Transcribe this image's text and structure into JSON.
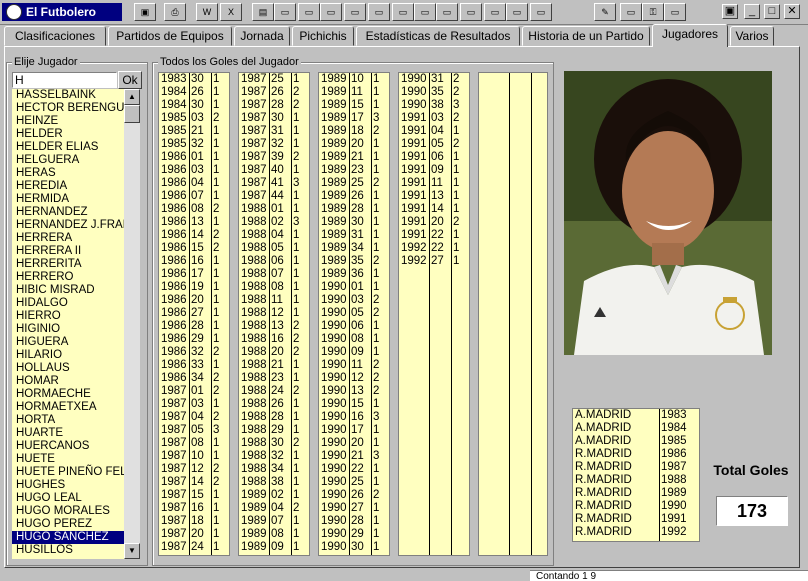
{
  "app": {
    "title": "El Futbolero"
  },
  "toolbar": {
    "buttons": [
      "save-icon",
      "print-icon",
      "word-icon",
      "excel-icon",
      "book-icon",
      "window-icon",
      "window-icon",
      "window-icon",
      "window-icon",
      "window-icon",
      "window-icon",
      "window-icon",
      "window-icon",
      "window-icon",
      "window-icon",
      "window-icon",
      "window-icon",
      "pdf-icon",
      "window-icon",
      "key-icon",
      "window-icon"
    ]
  },
  "tabs": [
    "Clasificaciones",
    "Partidos de Equipos",
    "Jornada",
    "Pichichis",
    "Estadísticas de Resultados",
    "Historia de un Partido",
    "Jugadores",
    "Varios"
  ],
  "active_tab": "Jugadores",
  "player_group": {
    "label": "Elije Jugador",
    "search_value": "H",
    "ok_label": "Ok"
  },
  "players": [
    "HASSELBAINK",
    "HECTOR BERENGUE",
    "HEINZE",
    "HELDER",
    "HELDER ELIAS",
    "HELGUERA",
    "HERAS",
    "HEREDIA",
    "HERMIDA",
    "HERNANDEZ",
    "HERNANDEZ J.FRAN",
    "HERRERA",
    "HERRERA II",
    "HERRERITA",
    "HERRERO",
    "HIBIC MISRAD",
    "HIDALGO",
    "HIERRO",
    "HIGINIO",
    "HIGUERA",
    "HILARIO",
    "HOLLAUS",
    "HOMAR",
    "HORMAECHE",
    "HORMAETXEA",
    "HORTA",
    "HUARTE",
    "HUERCANOS",
    "HUETE",
    "HUETE PINEÑO FELI",
    "HUGHES",
    "HUGO LEAL",
    "HUGO MORALES",
    "HUGO PEREZ",
    "HUGO SANCHEZ",
    "HUSILLOS"
  ],
  "selected_player": "HUGO SANCHEZ",
  "goals_group": {
    "label": "Todos los Goles del Jugador"
  },
  "goals_columns": [
    [
      [
        "1983",
        "30",
        "1"
      ],
      [
        "1984",
        "26",
        "1"
      ],
      [
        "1984",
        "30",
        "1"
      ],
      [
        "1985",
        "03",
        "2"
      ],
      [
        "1985",
        "21",
        "1"
      ],
      [
        "1985",
        "32",
        "1"
      ],
      [
        "1986",
        "01",
        "1"
      ],
      [
        "1986",
        "03",
        "1"
      ],
      [
        "1986",
        "04",
        "1"
      ],
      [
        "1986",
        "07",
        "1"
      ],
      [
        "1986",
        "08",
        "2"
      ],
      [
        "1986",
        "13",
        "1"
      ],
      [
        "1986",
        "14",
        "2"
      ],
      [
        "1986",
        "15",
        "2"
      ],
      [
        "1986",
        "16",
        "1"
      ],
      [
        "1986",
        "17",
        "1"
      ],
      [
        "1986",
        "19",
        "1"
      ],
      [
        "1986",
        "20",
        "1"
      ],
      [
        "1986",
        "27",
        "1"
      ],
      [
        "1986",
        "28",
        "1"
      ],
      [
        "1986",
        "29",
        "1"
      ],
      [
        "1986",
        "32",
        "2"
      ],
      [
        "1986",
        "33",
        "1"
      ],
      [
        "1986",
        "34",
        "2"
      ],
      [
        "1987",
        "01",
        "2"
      ],
      [
        "1987",
        "03",
        "1"
      ],
      [
        "1987",
        "04",
        "2"
      ],
      [
        "1987",
        "05",
        "3"
      ],
      [
        "1987",
        "08",
        "1"
      ],
      [
        "1987",
        "10",
        "1"
      ],
      [
        "1987",
        "12",
        "2"
      ],
      [
        "1987",
        "14",
        "2"
      ],
      [
        "1987",
        "15",
        "1"
      ],
      [
        "1987",
        "16",
        "1"
      ],
      [
        "1987",
        "18",
        "1"
      ],
      [
        "1987",
        "20",
        "1"
      ],
      [
        "1987",
        "24",
        "1"
      ]
    ],
    [
      [
        "1987",
        "25",
        "1"
      ],
      [
        "1987",
        "26",
        "2"
      ],
      [
        "1987",
        "28",
        "2"
      ],
      [
        "1987",
        "30",
        "1"
      ],
      [
        "1987",
        "31",
        "1"
      ],
      [
        "1987",
        "32",
        "1"
      ],
      [
        "1987",
        "39",
        "2"
      ],
      [
        "1987",
        "40",
        "1"
      ],
      [
        "1987",
        "41",
        "3"
      ],
      [
        "1987",
        "44",
        "1"
      ],
      [
        "1988",
        "01",
        "1"
      ],
      [
        "1988",
        "02",
        "3"
      ],
      [
        "1988",
        "04",
        "1"
      ],
      [
        "1988",
        "05",
        "1"
      ],
      [
        "1988",
        "06",
        "1"
      ],
      [
        "1988",
        "07",
        "1"
      ],
      [
        "1988",
        "08",
        "1"
      ],
      [
        "1988",
        "11",
        "1"
      ],
      [
        "1988",
        "12",
        "1"
      ],
      [
        "1988",
        "13",
        "2"
      ],
      [
        "1988",
        "16",
        "2"
      ],
      [
        "1988",
        "20",
        "2"
      ],
      [
        "1988",
        "21",
        "1"
      ],
      [
        "1988",
        "23",
        "1"
      ],
      [
        "1988",
        "24",
        "2"
      ],
      [
        "1988",
        "26",
        "1"
      ],
      [
        "1988",
        "28",
        "1"
      ],
      [
        "1988",
        "29",
        "1"
      ],
      [
        "1988",
        "30",
        "2"
      ],
      [
        "1988",
        "32",
        "1"
      ],
      [
        "1988",
        "34",
        "1"
      ],
      [
        "1988",
        "38",
        "1"
      ],
      [
        "1989",
        "02",
        "1"
      ],
      [
        "1989",
        "04",
        "2"
      ],
      [
        "1989",
        "07",
        "1"
      ],
      [
        "1989",
        "08",
        "1"
      ],
      [
        "1989",
        "09",
        "1"
      ]
    ],
    [
      [
        "1989",
        "10",
        "1"
      ],
      [
        "1989",
        "11",
        "1"
      ],
      [
        "1989",
        "15",
        "1"
      ],
      [
        "1989",
        "17",
        "3"
      ],
      [
        "1989",
        "18",
        "2"
      ],
      [
        "1989",
        "20",
        "1"
      ],
      [
        "1989",
        "21",
        "1"
      ],
      [
        "1989",
        "23",
        "1"
      ],
      [
        "1989",
        "25",
        "2"
      ],
      [
        "1989",
        "26",
        "1"
      ],
      [
        "1989",
        "28",
        "1"
      ],
      [
        "1989",
        "30",
        "1"
      ],
      [
        "1989",
        "31",
        "1"
      ],
      [
        "1989",
        "34",
        "1"
      ],
      [
        "1989",
        "35",
        "2"
      ],
      [
        "1989",
        "36",
        "1"
      ],
      [
        "1990",
        "01",
        "1"
      ],
      [
        "1990",
        "03",
        "2"
      ],
      [
        "1990",
        "05",
        "2"
      ],
      [
        "1990",
        "06",
        "1"
      ],
      [
        "1990",
        "08",
        "1"
      ],
      [
        "1990",
        "09",
        "1"
      ],
      [
        "1990",
        "11",
        "2"
      ],
      [
        "1990",
        "12",
        "2"
      ],
      [
        "1990",
        "13",
        "2"
      ],
      [
        "1990",
        "15",
        "1"
      ],
      [
        "1990",
        "16",
        "3"
      ],
      [
        "1990",
        "17",
        "1"
      ],
      [
        "1990",
        "20",
        "1"
      ],
      [
        "1990",
        "21",
        "3"
      ],
      [
        "1990",
        "22",
        "1"
      ],
      [
        "1990",
        "25",
        "1"
      ],
      [
        "1990",
        "26",
        "2"
      ],
      [
        "1990",
        "27",
        "1"
      ],
      [
        "1990",
        "28",
        "1"
      ],
      [
        "1990",
        "29",
        "1"
      ],
      [
        "1990",
        "30",
        "1"
      ]
    ],
    [
      [
        "1990",
        "31",
        "2"
      ],
      [
        "1990",
        "35",
        "2"
      ],
      [
        "1990",
        "38",
        "3"
      ],
      [
        "1991",
        "03",
        "2"
      ],
      [
        "1991",
        "04",
        "1"
      ],
      [
        "1991",
        "05",
        "2"
      ],
      [
        "1991",
        "06",
        "1"
      ],
      [
        "1991",
        "09",
        "1"
      ],
      [
        "1991",
        "11",
        "1"
      ],
      [
        "1991",
        "13",
        "1"
      ],
      [
        "1991",
        "14",
        "1"
      ],
      [
        "1991",
        "20",
        "2"
      ],
      [
        "1991",
        "22",
        "1"
      ],
      [
        "1992",
        "22",
        "1"
      ],
      [
        "1992",
        "27",
        "1"
      ]
    ],
    []
  ],
  "clubs": [
    [
      "A.MADRID",
      "1983"
    ],
    [
      "A.MADRID",
      "1984"
    ],
    [
      "A.MADRID",
      "1985"
    ],
    [
      "R.MADRID",
      "1986"
    ],
    [
      "R.MADRID",
      "1987"
    ],
    [
      "R.MADRID",
      "1988"
    ],
    [
      "R.MADRID",
      "1989"
    ],
    [
      "R.MADRID",
      "1990"
    ],
    [
      "R.MADRID",
      "1991"
    ],
    [
      "R.MADRID",
      "1992"
    ]
  ],
  "total": {
    "label": "Total Goles",
    "value": "173"
  },
  "status_text": "Contando 1 9"
}
